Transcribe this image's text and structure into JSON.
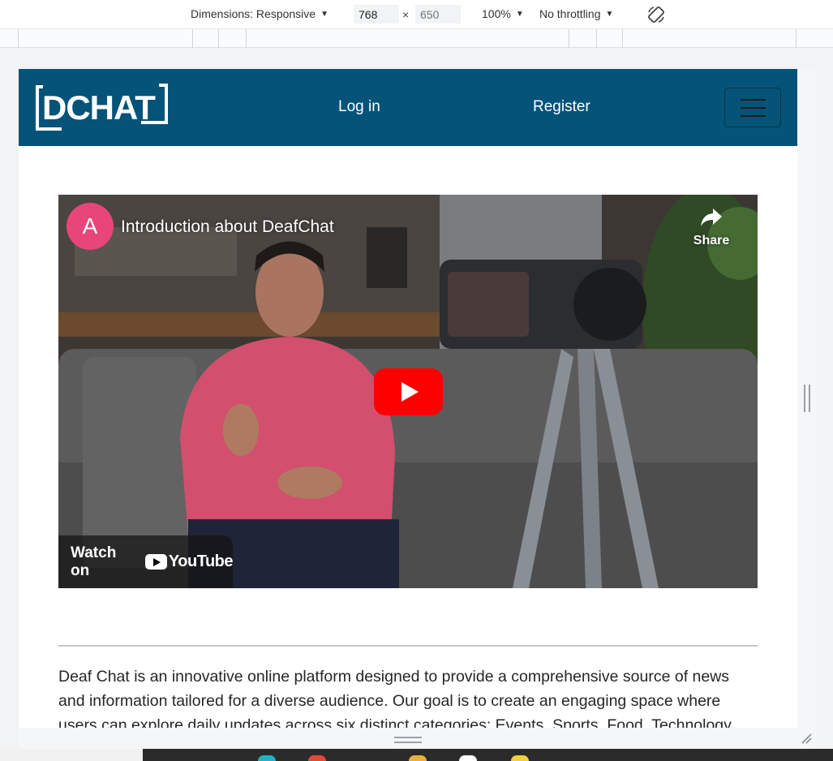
{
  "devtools": {
    "dimensions_label": "Dimensions: Responsive",
    "width_value": "768",
    "height_placeholder": "650",
    "times": "×",
    "zoom": "100%",
    "throttling": "No throttling",
    "caret": "▼"
  },
  "nav": {
    "logo_text": "DCHAT",
    "login": "Log in",
    "register": "Register"
  },
  "video": {
    "avatar_letter": "A",
    "title": "Introduction about DeafChat",
    "share": "Share",
    "watch_on": "Watch on",
    "youtube": "YouTube",
    "colors": {
      "play": "#ff0000",
      "avatar": "#e8457b"
    }
  },
  "content": {
    "description": "Deaf Chat is an innovative online platform designed to provide a comprehensive source of news and information tailored for a diverse audience. Our goal is to create an engaging space where users can explore daily updates across six distinct categories: Events, Sports, Food, Technology,"
  },
  "colors": {
    "navbar": "#055378"
  }
}
